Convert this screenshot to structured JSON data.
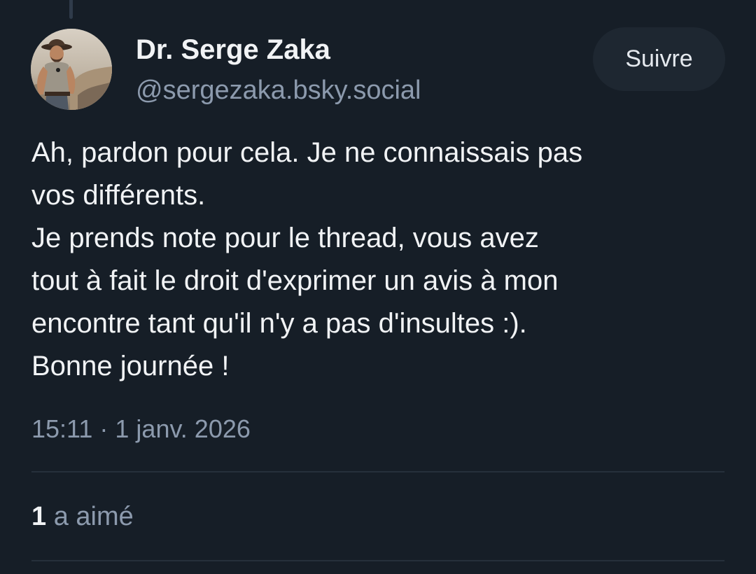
{
  "author": {
    "display_name": "Dr. Serge Zaka",
    "handle": "@sergezaka.bsky.social",
    "avatar_icon": "profile-photo"
  },
  "follow_button": {
    "label": "Suivre"
  },
  "post": {
    "lines": [
      "Ah, pardon pour cela. Je ne connaissais pas",
      "vos différents.",
      "Je prends note pour le thread, vous avez",
      "tout à fait le droit d'exprimer un avis à mon",
      "encontre tant qu'il n'y a pas d'insultes :).",
      "Bonne journée !"
    ],
    "timestamp": "15:11 · 1 janv. 2026"
  },
  "engagement": {
    "likes_count": "1",
    "likes_label": "a aimé"
  },
  "colors": {
    "background": "#161e27",
    "primary_text": "#f1f3f5",
    "secondary_text": "#8c9aad",
    "button_background": "#1e2731",
    "divider": "#26303b"
  }
}
